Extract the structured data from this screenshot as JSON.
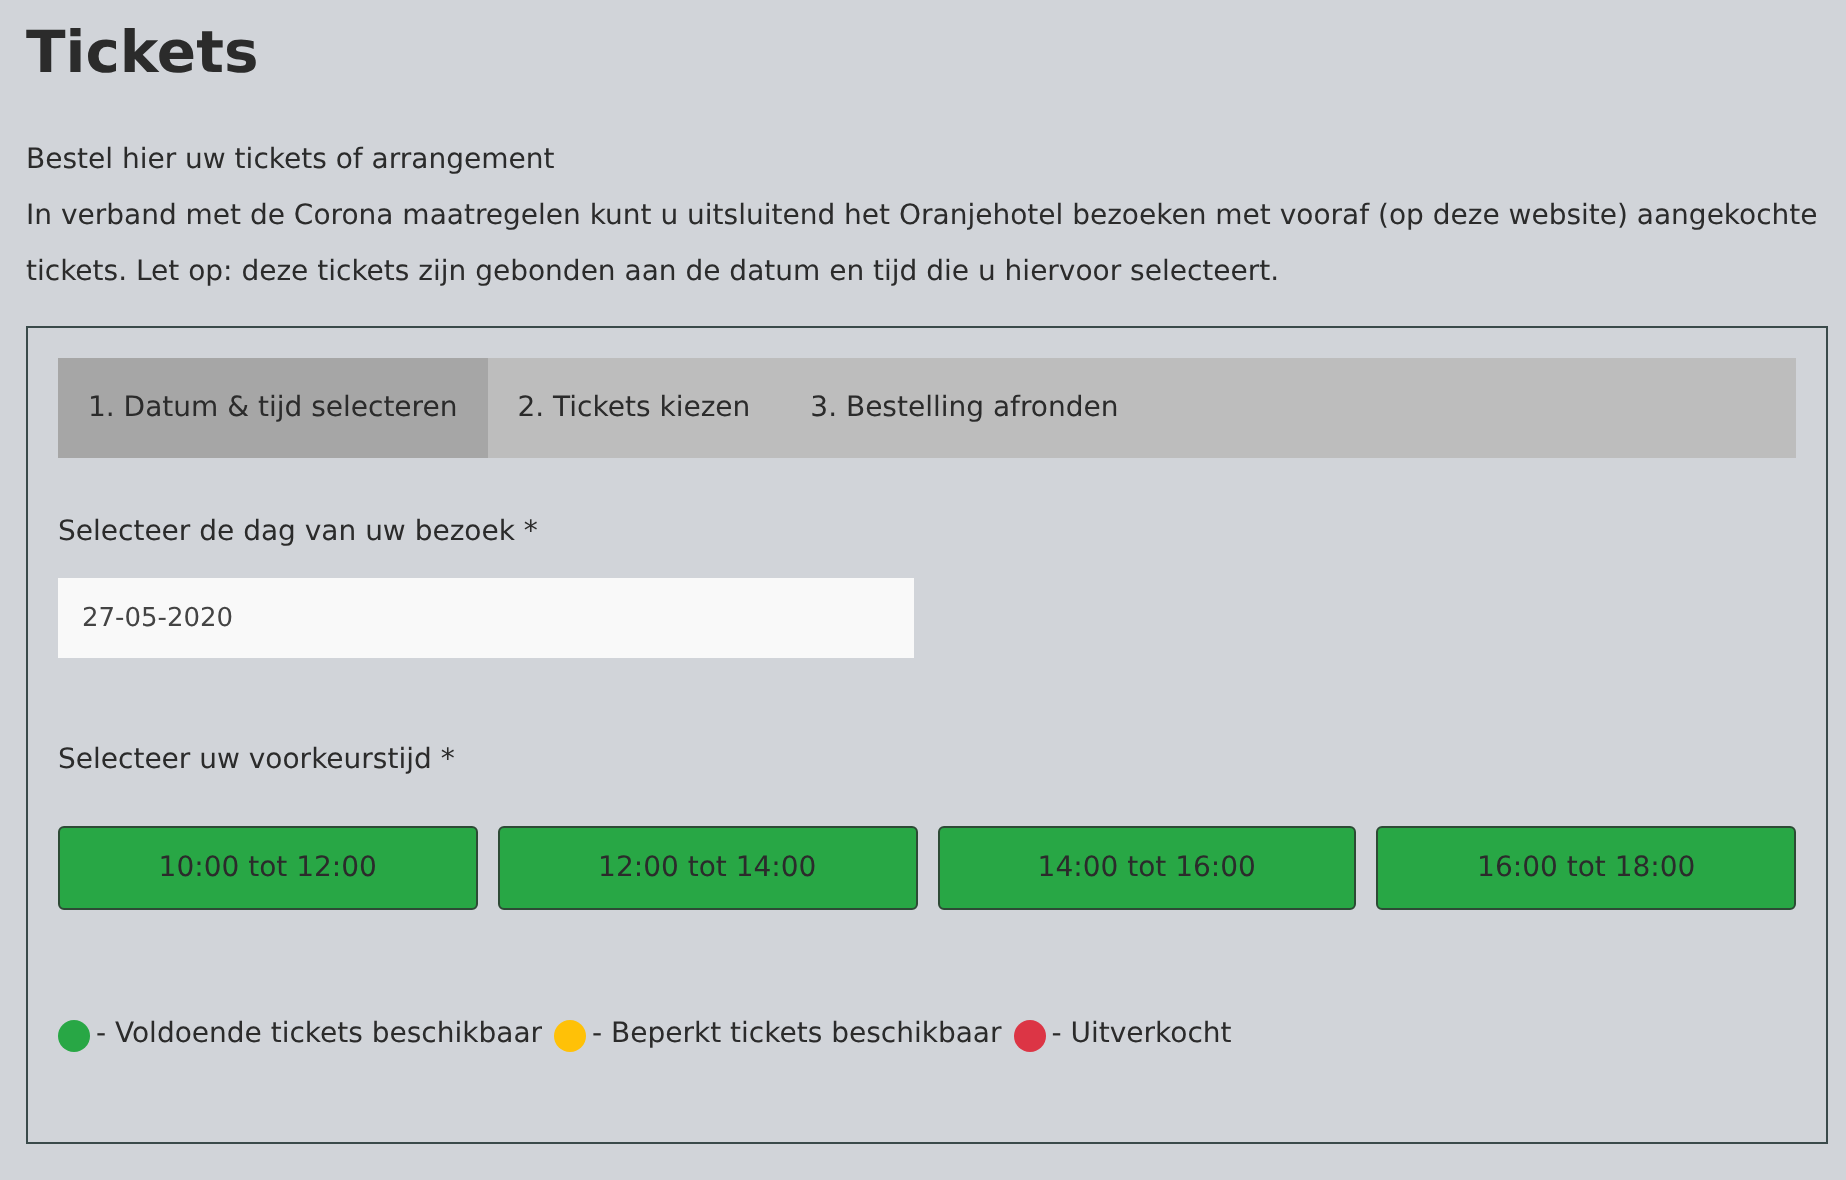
{
  "title": "Tickets",
  "intro": [
    "Bestel hier uw tickets of arrangement",
    "In verband met de Corona maatregelen kunt u uitsluitend het Oranjehotel bezoeken met vooraf (op deze website) aangekochte tickets. Let op: deze tickets zijn gebonden aan de datum en tijd die u hiervoor selecteert."
  ],
  "steps": [
    {
      "label": "1. Datum & tijd selecteren",
      "selected": true
    },
    {
      "label": "2. Tickets kiezen",
      "selected": false
    },
    {
      "label": "3. Bestelling afronden",
      "selected": false
    }
  ],
  "date_label": "Selecteer de dag van uw bezoek *",
  "date_field": {
    "value": "27-05-2020"
  },
  "time_label": "Selecteer uw voorkeurstijd *",
  "time_slots": [
    {
      "label": "10:00 tot 12:00",
      "color": "#28a745"
    },
    {
      "label": "12:00 tot 14:00",
      "color": "#28a745"
    },
    {
      "label": "14:00 tot 16:00",
      "color": "#28a745"
    },
    {
      "label": "16:00 tot 18:00",
      "color": "#28a745"
    }
  ],
  "legend": [
    {
      "label": "- Voldoende tickets beschikbaar",
      "color": "#28a745"
    },
    {
      "label": "- Beperkt tickets beschikbaar",
      "color": "#ffc107"
    },
    {
      "label": "- Uitverkocht",
      "color": "#dc3545"
    }
  ]
}
